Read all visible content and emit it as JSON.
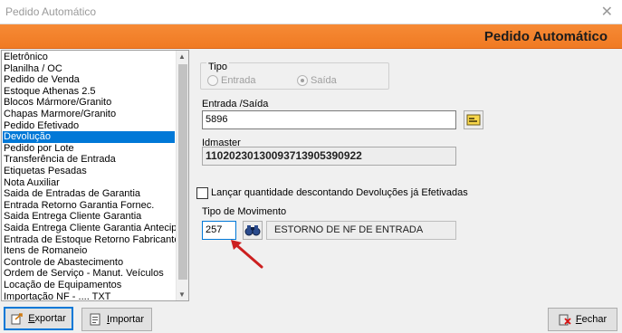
{
  "window": {
    "title": "Pedido Automático",
    "close_glyph": "✕"
  },
  "banner": {
    "title": "Pedido Automático"
  },
  "list": {
    "items": [
      "Eletrônico",
      "Planilha / OC",
      "Pedido de Venda",
      "Estoque Athenas 2.5",
      "Blocos Mármore/Granito",
      "Chapas Marmore/Granito",
      "Pedido Efetivado",
      "Devolução",
      "Pedido por Lote",
      "Transferência de Entrada",
      "Etiquetas Pesadas",
      "Nota Auxiliar",
      "Saida de Entradas de Garantia",
      "Entrada Retorno Garantia Fornec.",
      "Saida Entrega Cliente Garantia",
      "Saida Entrega Cliente Garantia Antecipa",
      "Entrada de Estoque Retorno Fabricante",
      "Itens de Romaneio",
      "Controle de Abastecimento",
      "Ordem de Serviço - Manut. Veículos",
      "Locação de Equipamentos",
      "Importação NF - .... TXT"
    ],
    "selected_index": 7
  },
  "tipo": {
    "legend": "Tipo",
    "options": [
      "Entrada",
      "Saída"
    ],
    "selected": "Saída"
  },
  "entrada_saida": {
    "label": "Entrada /Saída",
    "value": "5896"
  },
  "idmaster": {
    "label": "Idmaster",
    "value": "11020230130093713905390922"
  },
  "checkbox": {
    "label": "Lançar quantidade descontando Devoluções já Efetivadas",
    "checked": false
  },
  "movimento": {
    "label": "Tipo de Movimento",
    "code": "257",
    "description": "ESTORNO DE NF DE ENTRADA"
  },
  "footer": {
    "exportar": {
      "prefix": "E",
      "rest": "xportar"
    },
    "importar": {
      "prefix": "I",
      "rest": "mportar"
    },
    "fechar": {
      "prefix": "F",
      "rest": "echar"
    }
  },
  "colors": {
    "banner": "#f07a23",
    "selection": "#0078d7",
    "arrow": "#cc1f1f"
  }
}
